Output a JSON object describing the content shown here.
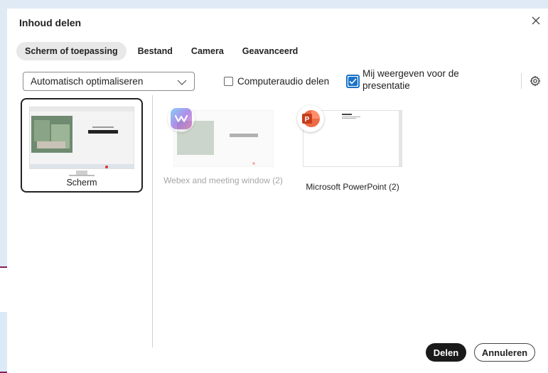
{
  "dialog": {
    "title": "Inhoud delen",
    "close_icon": "close-icon"
  },
  "tabs": [
    {
      "label": "Scherm of toepassing",
      "active": true
    },
    {
      "label": "Bestand",
      "active": false
    },
    {
      "label": "Camera",
      "active": false
    },
    {
      "label": "Geavanceerd",
      "active": false
    }
  ],
  "toolbar": {
    "optimize_select": "Automatisch optimaliseren",
    "computer_audio_label": "Computeraudio delen",
    "computer_audio_checked": false,
    "show_me_label": "Mij weergeven voor de presentatie",
    "show_me_checked": true,
    "settings_icon": "gear-icon"
  },
  "sources": [
    {
      "label": "Scherm",
      "selected": true,
      "enabled": true
    },
    {
      "label": "Webex and meeting window (2)",
      "selected": false,
      "enabled": false,
      "icon": "webex-icon"
    },
    {
      "label": "Microsoft PowerPoint (2)",
      "selected": false,
      "enabled": true,
      "icon": "powerpoint-icon"
    }
  ],
  "actions": {
    "share_label": "Delen",
    "cancel_label": "Annuleren"
  },
  "colors": {
    "accent": "#1a73c9",
    "primary_button": "#1a1a1a",
    "background": "#dfeaf5",
    "powerpoint": "#d04423",
    "left_card_border": "#8a1d5c"
  }
}
